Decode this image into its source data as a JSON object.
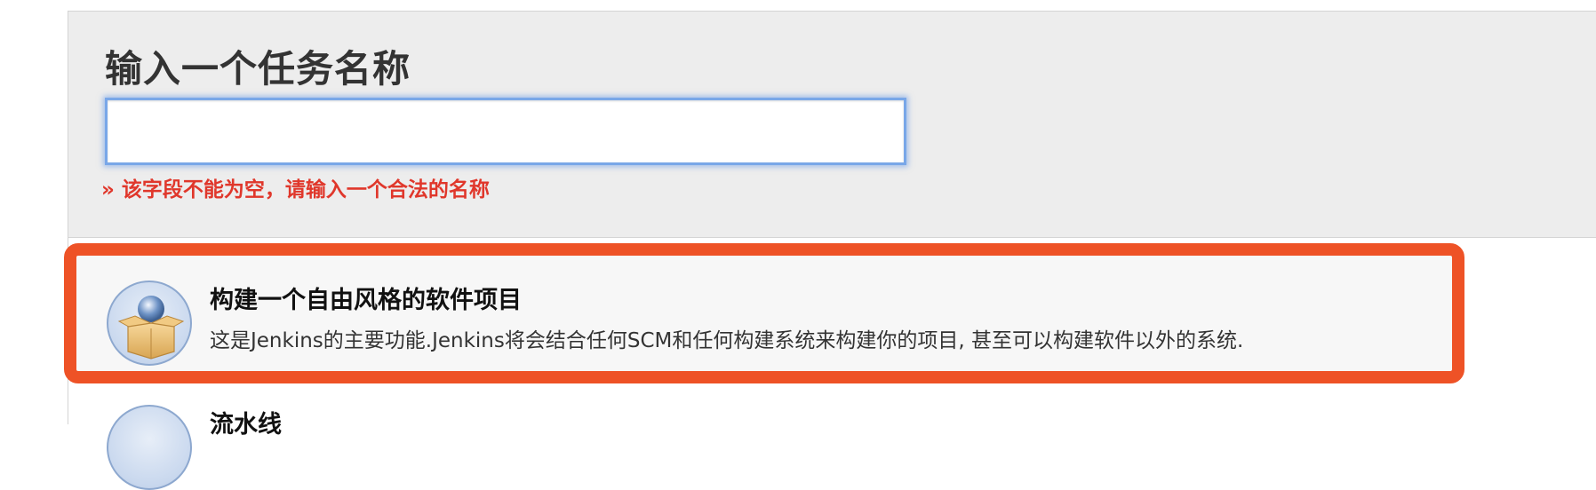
{
  "form": {
    "title": "输入一个任务名称",
    "name_input": {
      "value": "",
      "placeholder": ""
    },
    "error_message": "» 该字段不能为空，请输入一个合法的名称"
  },
  "item_types": [
    {
      "title": "构建一个自由风格的软件项目",
      "description": "这是Jenkins的主要功能.Jenkins将会结合任何SCM和任何构建系统来构建你的项目, 甚至可以构建软件以外的系统.",
      "icon": "freestyle-project-icon",
      "selected": true
    },
    {
      "title": "流水线",
      "icon": "pipeline-icon",
      "selected": false
    }
  ],
  "colors": {
    "highlight": "#ee5226",
    "error": "#e0372b",
    "input_focus": "#79a7e8"
  }
}
